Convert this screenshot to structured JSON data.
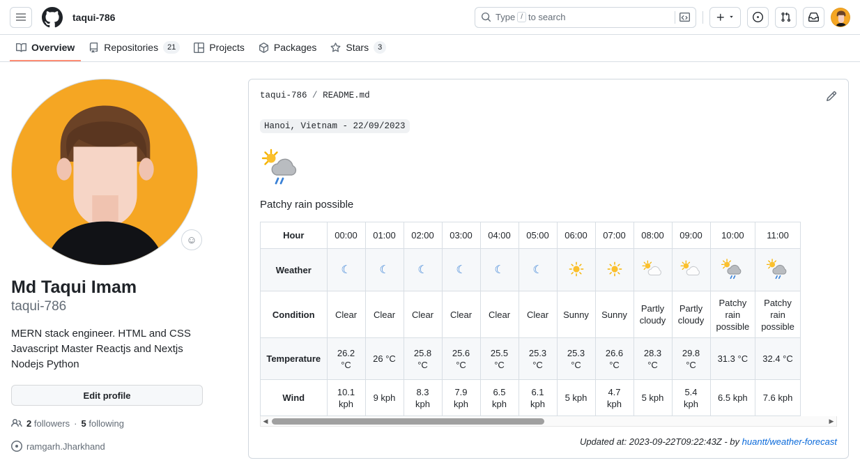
{
  "header": {
    "owner": "taqui-786",
    "menu_icon": "hamburger-icon",
    "logo_icon": "github-logo-icon",
    "search": {
      "placeholder_pre": "Type",
      "slash_key": "/",
      "placeholder_post": "to search",
      "terminal_icon": ">_"
    },
    "plus_label": "+",
    "icons": {
      "issues": "issues-icon",
      "pulls": "pull-requests-icon",
      "inbox": "inbox-icon",
      "avatar": "avatar-icon"
    }
  },
  "nav": {
    "tabs": [
      {
        "label": "Overview",
        "icon": "book-icon",
        "count": null,
        "active": true
      },
      {
        "label": "Repositories",
        "icon": "repo-icon",
        "count": "21",
        "active": false
      },
      {
        "label": "Projects",
        "icon": "projects-icon",
        "count": null,
        "active": false
      },
      {
        "label": "Packages",
        "icon": "package-icon",
        "count": null,
        "active": false
      },
      {
        "label": "Stars",
        "icon": "star-icon",
        "count": "3",
        "active": false
      }
    ]
  },
  "profile": {
    "fullname": "Md Taqui Imam",
    "username": "taqui-786",
    "bio": "MERN stack engineer. HTML and CSS Javascript Master Reactjs and Nextjs Nodejs Python",
    "edit_label": "Edit profile",
    "followers_count": "2",
    "followers_label": "followers",
    "separator": "·",
    "following_count": "5",
    "following_label": "following",
    "location": "ramgarh.Jharkhand",
    "status_emoji": "☺",
    "avatar_bg": "#f5a623"
  },
  "readme": {
    "breadcrumb_owner": "taqui-786",
    "breadcrumb_sep": "/",
    "breadcrumb_file": "README.md",
    "edit_icon": "pencil-icon",
    "location_tag": "Hanoi, Vietnam - 22/09/2023",
    "hero_icon": "sun-cloud-rain-icon",
    "current_condition": "Patchy rain possible",
    "updated_prefix": "Updated at: 2023-09-22T09:22:43Z - by",
    "updated_link": "huantt/weather-forecast"
  },
  "chart_data": {
    "type": "table",
    "title": "Hourly weather forecast - Hanoi, Vietnam - 22/09/2023",
    "row_labels": [
      "Hour",
      "Weather",
      "Condition",
      "Temperature",
      "Wind"
    ],
    "categories": [
      "00:00",
      "01:00",
      "02:00",
      "03:00",
      "04:00",
      "05:00",
      "06:00",
      "07:00",
      "08:00",
      "09:00",
      "10:00",
      "11:00"
    ],
    "weather_icons": [
      "moon",
      "moon",
      "moon",
      "moon",
      "moon",
      "moon",
      "sun",
      "sun",
      "sun-cloud",
      "sun-cloud",
      "sun-cloud-rain",
      "sun-cloud-rain"
    ],
    "conditions": [
      "Clear",
      "Clear",
      "Clear",
      "Clear",
      "Clear",
      "Clear",
      "Sunny",
      "Sunny",
      "Partly cloudy",
      "Partly cloudy",
      "Patchy rain possible",
      "Patchy rain possible"
    ],
    "temperature": [
      "26.2 °C",
      "26 °C",
      "25.8 °C",
      "25.6 °C",
      "25.5 °C",
      "25.3 °C",
      "25.3 °C",
      "26.6 °C",
      "28.3 °C",
      "29.8 °C",
      "31.3 °C",
      "32.4 °C"
    ],
    "temperature_values": [
      26.2,
      26,
      25.8,
      25.6,
      25.5,
      25.3,
      25.3,
      26.6,
      28.3,
      29.8,
      31.3,
      32.4
    ],
    "wind": [
      "10.1 kph",
      "9 kph",
      "8.3 kph",
      "7.9 kph",
      "6.5 kph",
      "6.1 kph",
      "5 kph",
      "4.7 kph",
      "5 kph",
      "5.4 kph",
      "6.5 kph",
      "7.6 kph"
    ],
    "wind_values": [
      10.1,
      9,
      8.3,
      7.9,
      6.5,
      6.1,
      5,
      4.7,
      5,
      5.4,
      6.5,
      7.6
    ],
    "units": {
      "temperature": "°C",
      "wind": "kph"
    }
  },
  "scrollbar": {
    "left_arrow": "◀",
    "right_arrow": "▶"
  }
}
